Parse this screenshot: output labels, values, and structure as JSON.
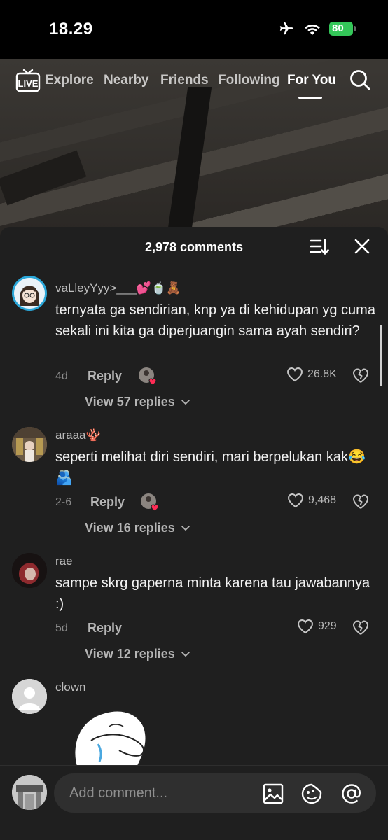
{
  "status": {
    "time": "18.29",
    "battery": "80"
  },
  "nav": {
    "live_label": "LIVE",
    "tabs": [
      "Explore",
      "Nearby",
      "Friends",
      "Following",
      "For You"
    ],
    "active_tab": "For You"
  },
  "comments_header": {
    "count_label": "2,978 comments"
  },
  "comments": [
    {
      "username": "vaLleyYyy>___💕🍵🧸",
      "text": "ternyata ga sendirian, knp ya di kehidupan yg cuma sekali ini kita ga diperjuangin sama ayah sendiri?",
      "date": "4d",
      "reply_label": "Reply",
      "likes": "26.8K",
      "view_replies": "View 57 replies"
    },
    {
      "username": "araaa🪸",
      "text": "seperti melihat diri sendiri, mari berpelukan kak😂🫂",
      "date": "2-6",
      "reply_label": "Reply",
      "likes": "9,468",
      "view_replies": "View 16 replies"
    },
    {
      "username": "rae",
      "text": "sampe skrg gaperna minta karena tau jawabannya :)",
      "date": "5d",
      "reply_label": "Reply",
      "likes": "929",
      "view_replies": "View 12 replies"
    },
    {
      "username": "clown"
    }
  ],
  "input": {
    "placeholder": "Add comment..."
  },
  "colors": {
    "sheet_bg": "#1f1f1f",
    "battery_green": "#34c759",
    "heart_red": "#fe2c55"
  }
}
